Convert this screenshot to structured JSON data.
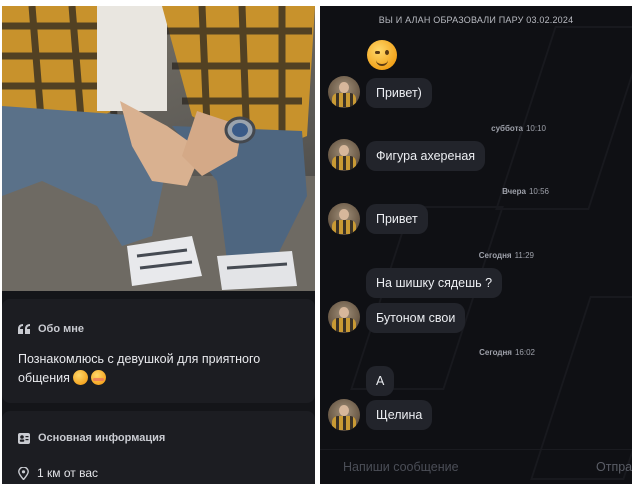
{
  "profile": {
    "photo_alt": "",
    "about": {
      "icon": "quote-icon",
      "heading": "Обо мне",
      "text": "Познакомлюсь с девушкой для приятного общения"
    },
    "info": {
      "icon": "id-card-icon",
      "heading": "Основная информация",
      "distance_icon": "location-pin-icon",
      "distance": "1 км от вас"
    }
  },
  "chat": {
    "pair_header": "ВЫ И АЛАН ОБРАЗОВАЛИ ПАРУ 03.02.2024",
    "messages": [
      {
        "text": "Привет)"
      },
      {
        "day": "суббота",
        "time": "10:10",
        "text": "Фигура ахереная"
      },
      {
        "day": "Вчера",
        "time": "10:56",
        "text": "Привет"
      },
      {
        "day": "Сегодня",
        "time": "11:29",
        "text": "На шишку сядешь ?"
      },
      {
        "text": "Бутоном свои"
      },
      {
        "day": "Сегодня",
        "time": "16:02",
        "text": "А"
      },
      {
        "text": "Щелина"
      }
    ],
    "composer": {
      "placeholder": "Напиши сообщение",
      "send_label": "Отпра"
    }
  }
}
